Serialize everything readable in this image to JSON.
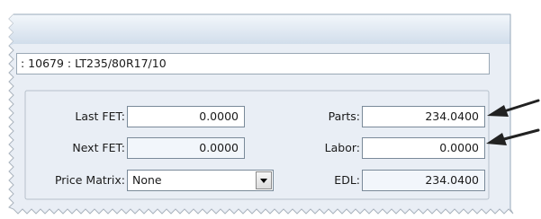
{
  "item": {
    "description": ": 10679 : LT235/80R17/10"
  },
  "pricing": {
    "last_fet_label": "Last FET:",
    "last_fet_value": "0.0000",
    "next_fet_label": "Next FET:",
    "next_fet_value": "0.0000",
    "price_matrix_label": "Price Matrix:",
    "price_matrix_value": "None",
    "parts_label": "Parts:",
    "parts_value": "234.0400",
    "labor_label": "Labor:",
    "labor_value": "0.0000",
    "edl_label": "EDL:",
    "edl_value": "234.0400"
  },
  "colors": {
    "title_bar_top": "#f3f7fb",
    "title_bar_bottom": "#cfdcea",
    "panel_background": "#e9eef5",
    "readonly_field": "#f2f6fb",
    "arrow": "#222222"
  },
  "icons": [
    "chevron-down-icon",
    "arrow-left-icon"
  ]
}
